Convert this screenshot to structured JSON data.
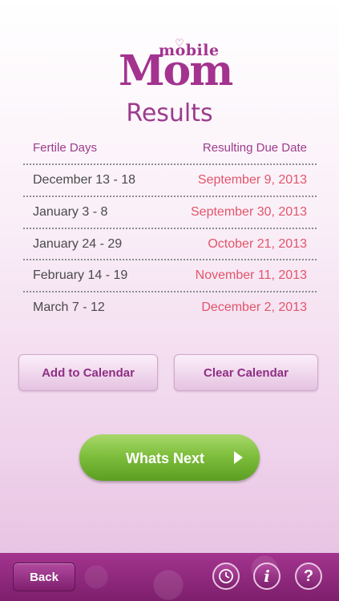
{
  "logo": {
    "small": "mobile",
    "big": "Mom"
  },
  "title": "Results",
  "columns": {
    "left": "Fertile Days",
    "right": "Resulting Due Date"
  },
  "rows": [
    {
      "fertile": "December 13 - 18",
      "due": "September 9, 2013"
    },
    {
      "fertile": "January 3 - 8",
      "due": "September 30, 2013"
    },
    {
      "fertile": "January 24 - 29",
      "due": "October 21, 2013"
    },
    {
      "fertile": "February 14 - 19",
      "due": "November 11, 2013"
    },
    {
      "fertile": "March 7 - 12",
      "due": "December 2, 2013"
    }
  ],
  "buttons": {
    "add_calendar": "Add to Calendar",
    "clear_calendar": "Clear Calendar",
    "whats_next": "Whats Next"
  },
  "bottom_bar": {
    "back": "Back",
    "info": "i",
    "help": "?"
  },
  "colors": {
    "brand": "#a3338f",
    "due_date": "#e2556b",
    "next_green": "#7fbf3d"
  }
}
